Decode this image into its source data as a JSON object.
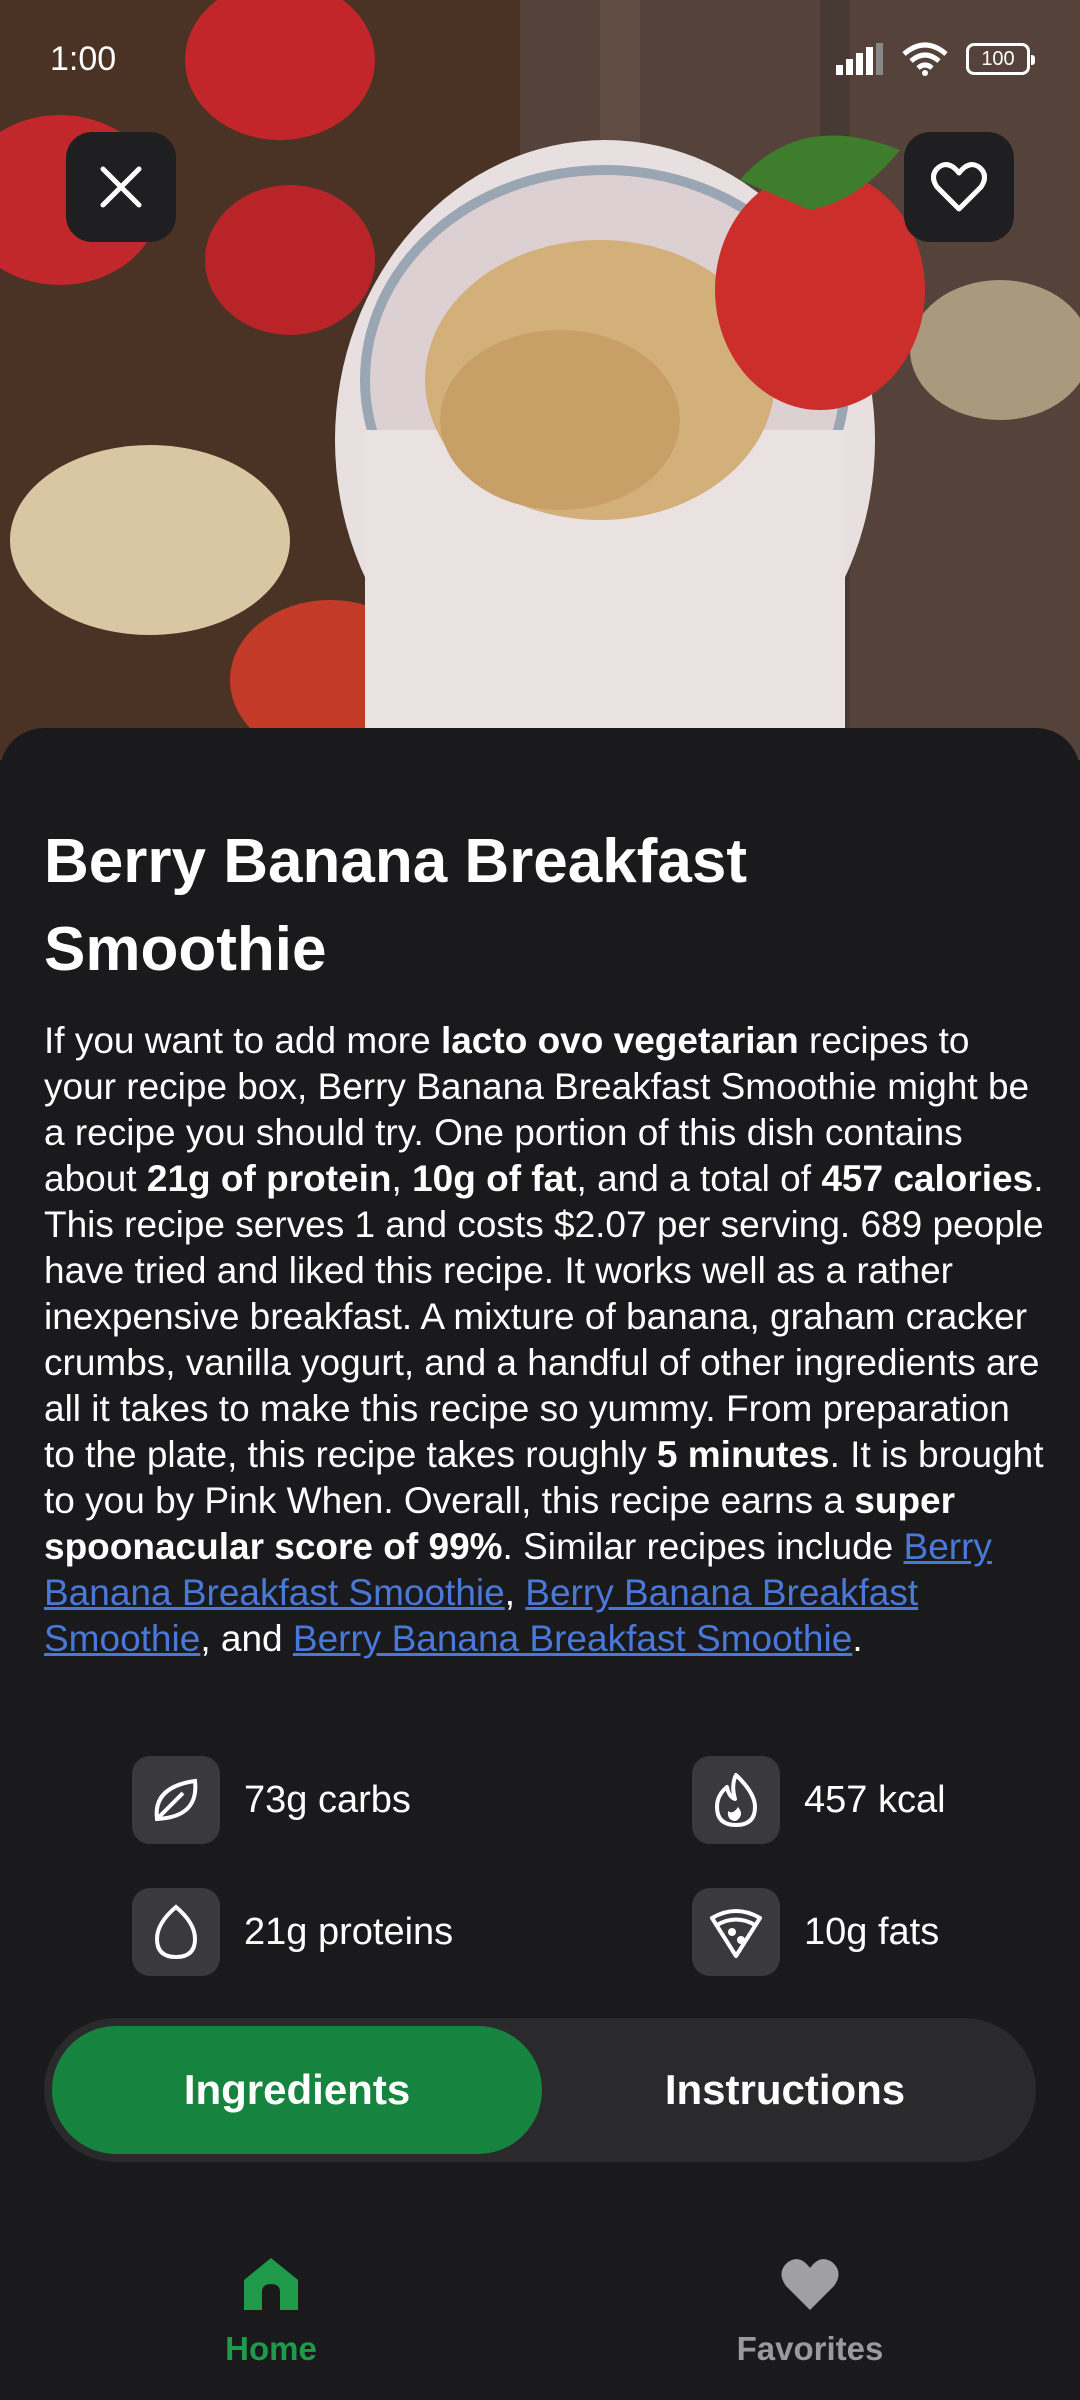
{
  "status_bar": {
    "time": "1:00",
    "battery": "100"
  },
  "hero": {
    "image_icon": "smoothie-photo"
  },
  "recipe": {
    "title": "Berry Banana Breakfast Smoothie",
    "description": {
      "p1": "If you want to add more ",
      "b1": "lacto ovo vegetarian",
      "p2": " recipes to your recipe box, Berry Banana Breakfast Smoothie might be a recipe you should try. One portion of this dish contains about ",
      "b2": "21g of protein",
      "p3": ", ",
      "b3": "10g of fat",
      "p4": ", and a total of ",
      "b4": "457 calories",
      "p5": ". This recipe serves 1 and costs $2.07 per serving. 689 people have tried and liked this recipe. It works well as a rather inexpensive breakfast. A mixture of banana, graham cracker crumbs, vanilla yogurt, and a handful of other ingredients are all it takes to make this recipe so yummy. From preparation to the plate, this recipe takes roughly ",
      "b5": "5 minutes",
      "p6": ". It is brought to you by Pink When. Overall, this recipe earns a ",
      "b6": "super spoonacular score of 99%",
      "p7": ". Similar recipes include ",
      "link1": "Berry Banana Breakfast Smoothie",
      "p8": ", ",
      "link2": "Berry Banana Breakfast Smoothie",
      "p9": ", and ",
      "link3": "Berry Banana Breakfast Smoothie",
      "p10": "."
    },
    "nutrition": {
      "carbs": "73g carbs",
      "kcal": "457 kcal",
      "proteins": "21g proteins",
      "fats": "10g fats"
    }
  },
  "tabs": {
    "ingredients": "Ingredients",
    "instructions": "Instructions",
    "selected": "Ingredients"
  },
  "bottom_nav": {
    "home": "Home",
    "favorites": "Favorites"
  },
  "colors": {
    "accent": "#16843e",
    "link": "#4a78d8",
    "background": "#1a1a1c"
  }
}
